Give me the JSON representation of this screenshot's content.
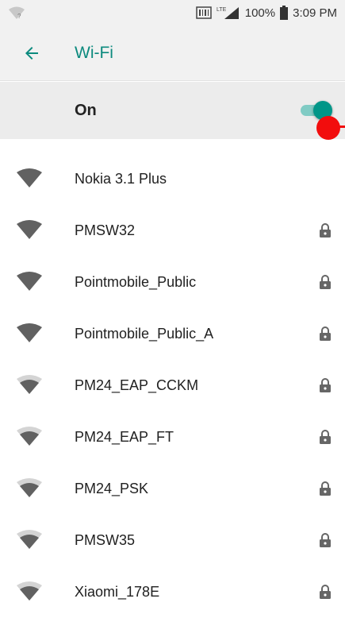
{
  "status_bar": {
    "battery": "100%",
    "time": "3:09 PM",
    "network": "LTE"
  },
  "app_bar": {
    "title": "Wi-Fi",
    "back_icon": "arrow-back-icon"
  },
  "wifi_toggle": {
    "label": "On",
    "state": "on"
  },
  "colors": {
    "accent": "#0c8a7e",
    "switch_thumb": "#009688",
    "switch_track": "#80cbc4",
    "touch_indicator": "#f20d0d"
  },
  "networks": [
    {
      "ssid": "Nokia 3.1 Plus",
      "signal": "strong",
      "secured": false
    },
    {
      "ssid": "PMSW32",
      "signal": "strong",
      "secured": true
    },
    {
      "ssid": "Pointmobile_Public",
      "signal": "strong",
      "secured": true
    },
    {
      "ssid": "Pointmobile_Public_A",
      "signal": "strong",
      "secured": true
    },
    {
      "ssid": "PM24_EAP_CCKM",
      "signal": "medium",
      "secured": true
    },
    {
      "ssid": "PM24_EAP_FT",
      "signal": "medium",
      "secured": true
    },
    {
      "ssid": "PM24_PSK",
      "signal": "medium",
      "secured": true
    },
    {
      "ssid": "PMSW35",
      "signal": "medium",
      "secured": true
    },
    {
      "ssid": "Xiaomi_178E",
      "signal": "medium",
      "secured": true
    }
  ]
}
